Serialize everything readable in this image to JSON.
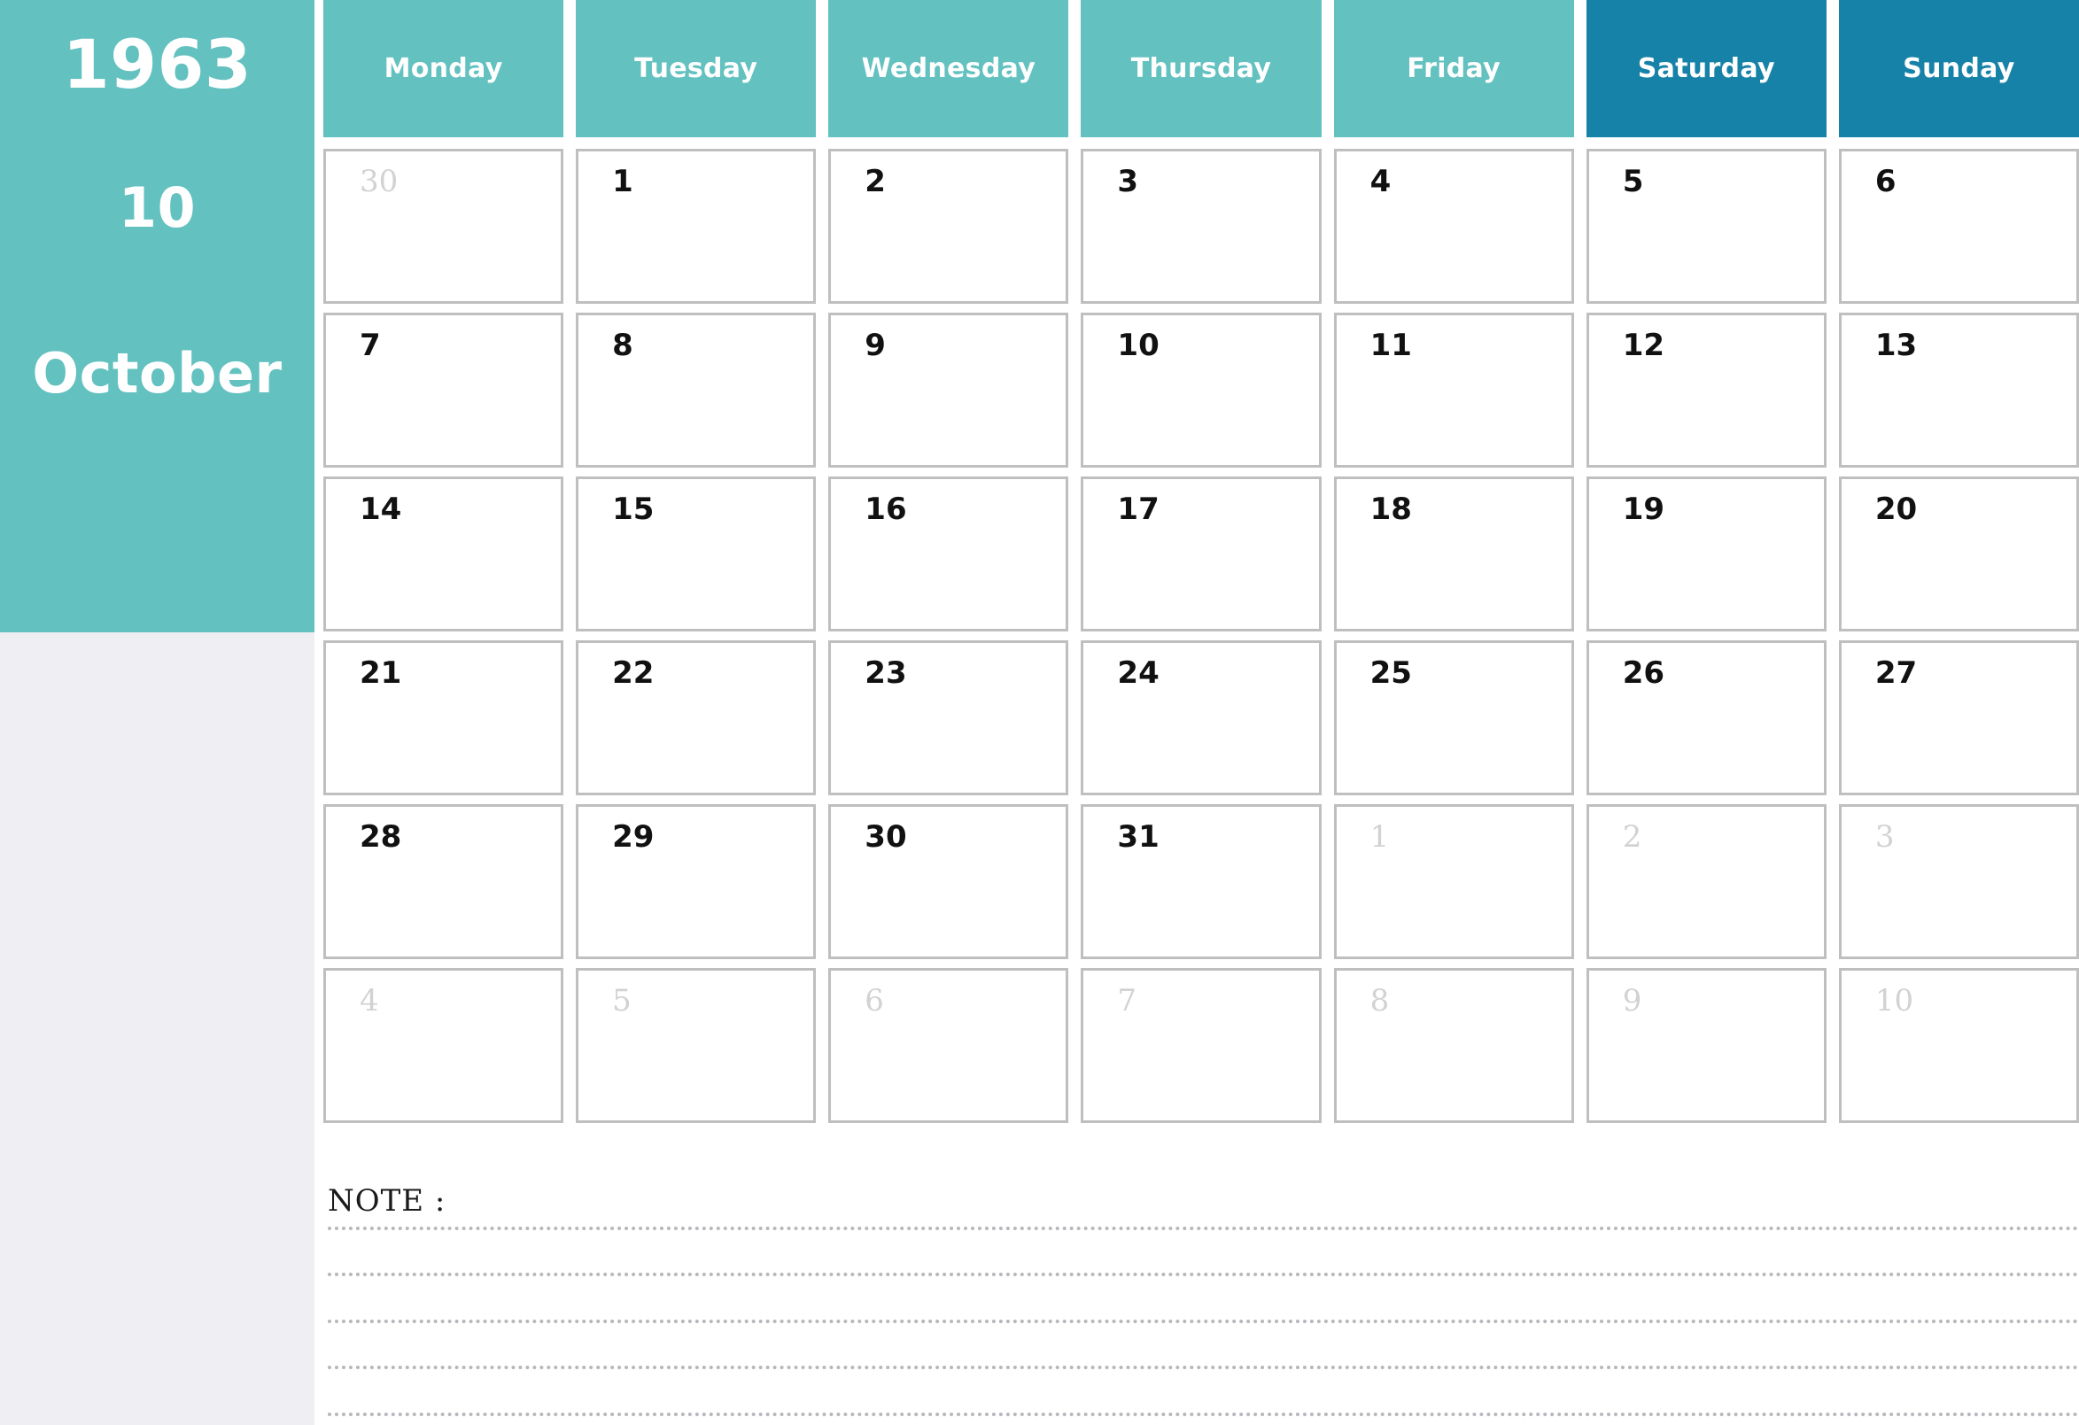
{
  "sidebar": {
    "year": "1963",
    "month_number": "10",
    "month_name": "October",
    "background_color": "#63C1C0",
    "lower_background_color": "#EFEFF3",
    "text_color": "#ffffff"
  },
  "header": {
    "weekday_color": "#63C1C0",
    "weekend_color": "#1782A8",
    "days": [
      {
        "label": "Monday",
        "type": "weekday"
      },
      {
        "label": "Tuesday",
        "type": "weekday"
      },
      {
        "label": "Wednesday",
        "type": "weekday"
      },
      {
        "label": "Thursday",
        "type": "weekday"
      },
      {
        "label": "Friday",
        "type": "weekday"
      },
      {
        "label": "Saturday",
        "type": "weekend"
      },
      {
        "label": "Sunday",
        "type": "weekend"
      }
    ]
  },
  "grid": {
    "cell_border_color": "#BFBFBF",
    "current_month_number_color": "#111111",
    "outside_month_number_color": "#D2D2D2",
    "weeks": [
      [
        {
          "number": "30",
          "in_month": false
        },
        {
          "number": "1",
          "in_month": true
        },
        {
          "number": "2",
          "in_month": true
        },
        {
          "number": "3",
          "in_month": true
        },
        {
          "number": "4",
          "in_month": true
        },
        {
          "number": "5",
          "in_month": true
        },
        {
          "number": "6",
          "in_month": true
        }
      ],
      [
        {
          "number": "7",
          "in_month": true
        },
        {
          "number": "8",
          "in_month": true
        },
        {
          "number": "9",
          "in_month": true
        },
        {
          "number": "10",
          "in_month": true
        },
        {
          "number": "11",
          "in_month": true
        },
        {
          "number": "12",
          "in_month": true
        },
        {
          "number": "13",
          "in_month": true
        }
      ],
      [
        {
          "number": "14",
          "in_month": true
        },
        {
          "number": "15",
          "in_month": true
        },
        {
          "number": "16",
          "in_month": true
        },
        {
          "number": "17",
          "in_month": true
        },
        {
          "number": "18",
          "in_month": true
        },
        {
          "number": "19",
          "in_month": true
        },
        {
          "number": "20",
          "in_month": true
        }
      ],
      [
        {
          "number": "21",
          "in_month": true
        },
        {
          "number": "22",
          "in_month": true
        },
        {
          "number": "23",
          "in_month": true
        },
        {
          "number": "24",
          "in_month": true
        },
        {
          "number": "25",
          "in_month": true
        },
        {
          "number": "26",
          "in_month": true
        },
        {
          "number": "27",
          "in_month": true
        }
      ],
      [
        {
          "number": "28",
          "in_month": true
        },
        {
          "number": "29",
          "in_month": true
        },
        {
          "number": "30",
          "in_month": true
        },
        {
          "number": "31",
          "in_month": true
        },
        {
          "number": "1",
          "in_month": false
        },
        {
          "number": "2",
          "in_month": false
        },
        {
          "number": "3",
          "in_month": false
        }
      ],
      [
        {
          "number": "4",
          "in_month": false
        },
        {
          "number": "5",
          "in_month": false
        },
        {
          "number": "6",
          "in_month": false
        },
        {
          "number": "7",
          "in_month": false
        },
        {
          "number": "8",
          "in_month": false
        },
        {
          "number": "9",
          "in_month": false
        },
        {
          "number": "10",
          "in_month": false
        }
      ]
    ]
  },
  "note": {
    "label": "NOTE :",
    "rule_count": 5,
    "rule_color": "#B7B7BC"
  }
}
